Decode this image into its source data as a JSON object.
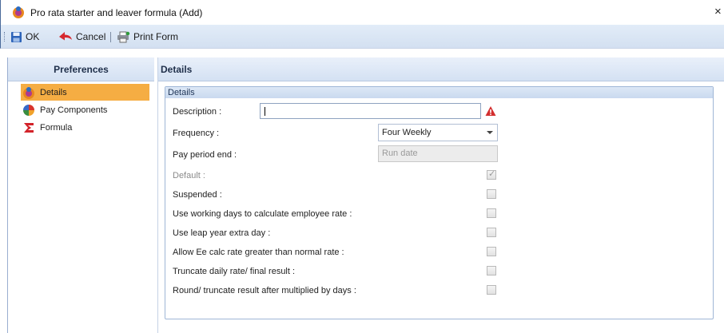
{
  "window": {
    "title": "Pro rata starter and leaver formula (Add)",
    "close_glyph": "×"
  },
  "toolbar": {
    "ok_label": "OK",
    "cancel_label": "Cancel",
    "print_label": "Print Form"
  },
  "sidebar": {
    "header": "Preferences",
    "items": [
      {
        "label": "Details",
        "icon": "details-icon",
        "active": true
      },
      {
        "label": "Pay Components",
        "icon": "pay-components-icon",
        "active": false
      },
      {
        "label": "Formula",
        "icon": "formula-icon",
        "active": false
      }
    ]
  },
  "details": {
    "header": "Details",
    "group_title": "Details",
    "description_label": "Description :",
    "description_value": "",
    "frequency_label": "Frequency :",
    "frequency_value": "Four Weekly",
    "pay_period_end_label": "Pay period end :",
    "pay_period_end_value": "Run date",
    "checkboxes": [
      {
        "label": "Default :",
        "checked": true,
        "disabled": true
      },
      {
        "label": "Suspended :",
        "checked": false,
        "disabled": false
      },
      {
        "label": "Use working days to calculate employee rate :",
        "checked": false,
        "disabled": false
      },
      {
        "label": "Use leap year extra day :",
        "checked": false,
        "disabled": false
      },
      {
        "label": "Allow Ee calc rate greater than normal rate :",
        "checked": false,
        "disabled": false
      },
      {
        "label": "Truncate daily rate/ final result :",
        "checked": false,
        "disabled": false
      },
      {
        "label": "Round/ truncate result after multiplied by days :",
        "checked": false,
        "disabled": false
      }
    ]
  },
  "colors": {
    "active_nav": "#f5ad43",
    "warning": "#d32f2f",
    "header_bg": "#d4e1f3"
  }
}
